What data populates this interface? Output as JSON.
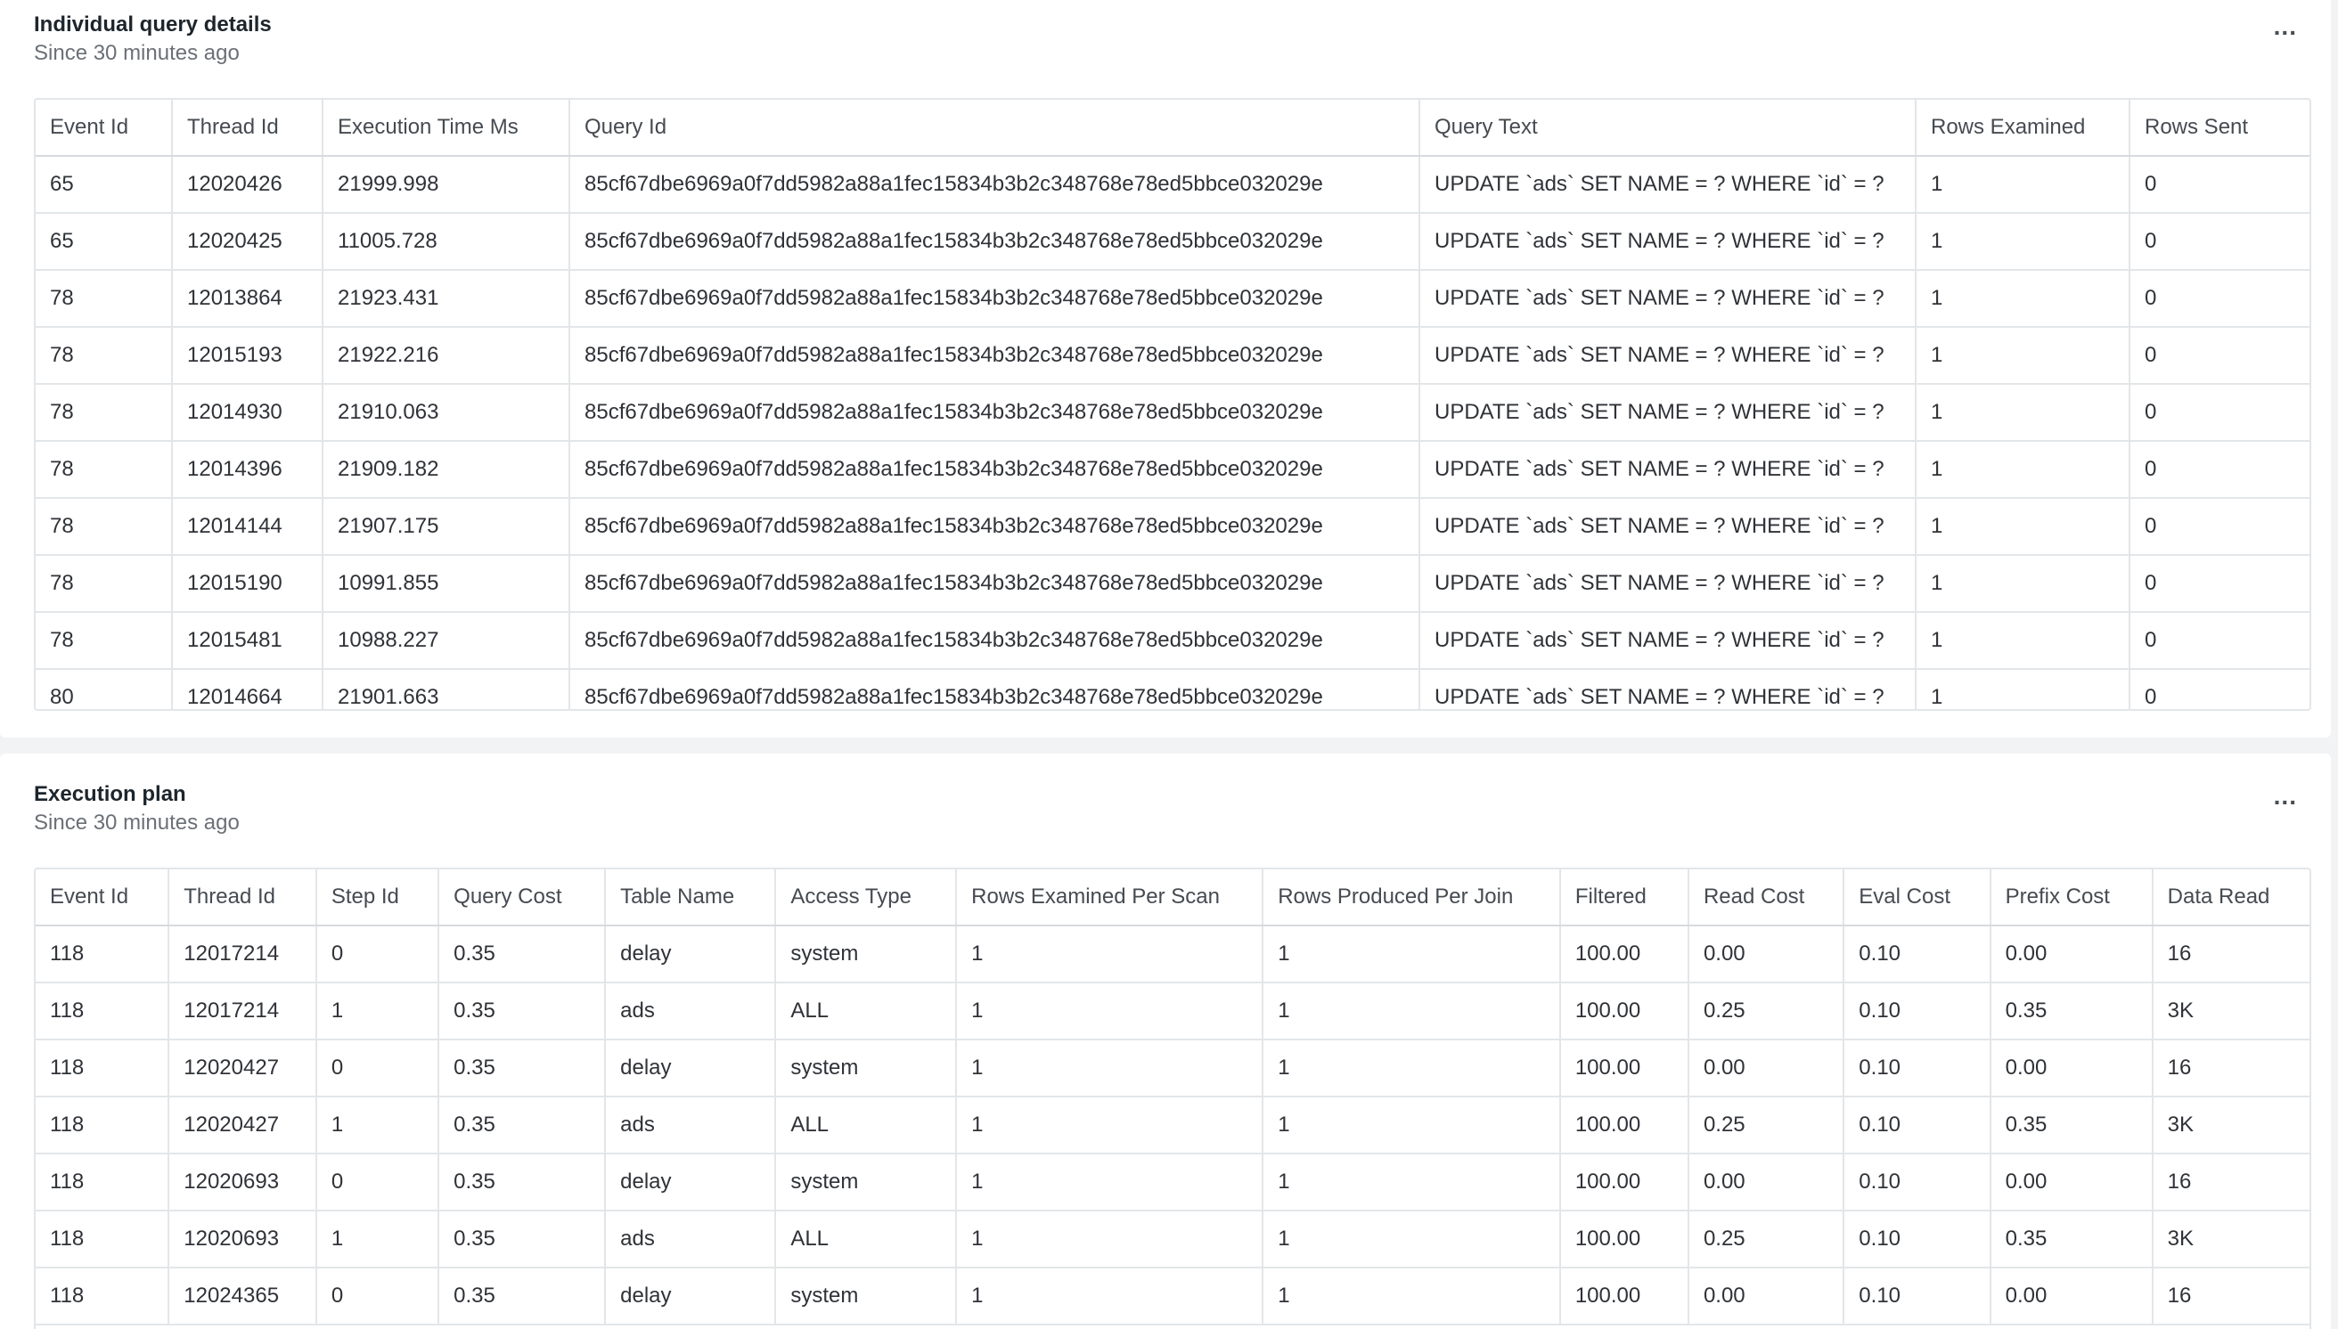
{
  "panels": [
    {
      "title": "Individual query details",
      "subtitle": "Since 30 minutes ago",
      "menu_label": "...",
      "columns": [
        "Event Id",
        "Thread Id",
        "Execution Time Ms",
        "Query Id",
        "Query Text",
        "Rows Examined",
        "Rows Sent"
      ],
      "rows": [
        [
          "65",
          "12020426",
          "21999.998",
          "85cf67dbe6969a0f7dd5982a88a1fec15834b3b2c348768e78ed5bbce032029e",
          "UPDATE `ads` SET NAME = ? WHERE `id` = ?",
          "1",
          "0"
        ],
        [
          "65",
          "12020425",
          "11005.728",
          "85cf67dbe6969a0f7dd5982a88a1fec15834b3b2c348768e78ed5bbce032029e",
          "UPDATE `ads` SET NAME = ? WHERE `id` = ?",
          "1",
          "0"
        ],
        [
          "78",
          "12013864",
          "21923.431",
          "85cf67dbe6969a0f7dd5982a88a1fec15834b3b2c348768e78ed5bbce032029e",
          "UPDATE `ads` SET NAME = ? WHERE `id` = ?",
          "1",
          "0"
        ],
        [
          "78",
          "12015193",
          "21922.216",
          "85cf67dbe6969a0f7dd5982a88a1fec15834b3b2c348768e78ed5bbce032029e",
          "UPDATE `ads` SET NAME = ? WHERE `id` = ?",
          "1",
          "0"
        ],
        [
          "78",
          "12014930",
          "21910.063",
          "85cf67dbe6969a0f7dd5982a88a1fec15834b3b2c348768e78ed5bbce032029e",
          "UPDATE `ads` SET NAME = ? WHERE `id` = ?",
          "1",
          "0"
        ],
        [
          "78",
          "12014396",
          "21909.182",
          "85cf67dbe6969a0f7dd5982a88a1fec15834b3b2c348768e78ed5bbce032029e",
          "UPDATE `ads` SET NAME = ? WHERE `id` = ?",
          "1",
          "0"
        ],
        [
          "78",
          "12014144",
          "21907.175",
          "85cf67dbe6969a0f7dd5982a88a1fec15834b3b2c348768e78ed5bbce032029e",
          "UPDATE `ads` SET NAME = ? WHERE `id` = ?",
          "1",
          "0"
        ],
        [
          "78",
          "12015190",
          "10991.855",
          "85cf67dbe6969a0f7dd5982a88a1fec15834b3b2c348768e78ed5bbce032029e",
          "UPDATE `ads` SET NAME = ? WHERE `id` = ?",
          "1",
          "0"
        ],
        [
          "78",
          "12015481",
          "10988.227",
          "85cf67dbe6969a0f7dd5982a88a1fec15834b3b2c348768e78ed5bbce032029e",
          "UPDATE `ads` SET NAME = ? WHERE `id` = ?",
          "1",
          "0"
        ],
        [
          "80",
          "12014664",
          "21901.663",
          "85cf67dbe6969a0f7dd5982a88a1fec15834b3b2c348768e78ed5bbce032029e",
          "UPDATE `ads` SET NAME = ? WHERE `id` = ?",
          "1",
          "0"
        ]
      ]
    },
    {
      "title": "Execution plan",
      "subtitle": "Since 30 minutes ago",
      "menu_label": "...",
      "columns": [
        "Event Id",
        "Thread Id",
        "Step Id",
        "Query Cost",
        "Table Name",
        "Access Type",
        "Rows Examined Per Scan",
        "Rows Produced Per Join",
        "Filtered",
        "Read Cost",
        "Eval Cost",
        "Prefix Cost",
        "Data Read"
      ],
      "rows": [
        [
          "118",
          "12017214",
          "0",
          "0.35",
          "delay",
          "system",
          "1",
          "1",
          "100.00",
          "0.00",
          "0.10",
          "0.00",
          "16"
        ],
        [
          "118",
          "12017214",
          "1",
          "0.35",
          "ads",
          "ALL",
          "1",
          "1",
          "100.00",
          "0.25",
          "0.10",
          "0.35",
          "3K"
        ],
        [
          "118",
          "12020427",
          "0",
          "0.35",
          "delay",
          "system",
          "1",
          "1",
          "100.00",
          "0.00",
          "0.10",
          "0.00",
          "16"
        ],
        [
          "118",
          "12020427",
          "1",
          "0.35",
          "ads",
          "ALL",
          "1",
          "1",
          "100.00",
          "0.25",
          "0.10",
          "0.35",
          "3K"
        ],
        [
          "118",
          "12020693",
          "0",
          "0.35",
          "delay",
          "system",
          "1",
          "1",
          "100.00",
          "0.00",
          "0.10",
          "0.00",
          "16"
        ],
        [
          "118",
          "12020693",
          "1",
          "0.35",
          "ads",
          "ALL",
          "1",
          "1",
          "100.00",
          "0.25",
          "0.10",
          "0.35",
          "3K"
        ],
        [
          "118",
          "12024365",
          "0",
          "0.35",
          "delay",
          "system",
          "1",
          "1",
          "100.00",
          "0.00",
          "0.10",
          "0.00",
          "16"
        ]
      ]
    }
  ]
}
